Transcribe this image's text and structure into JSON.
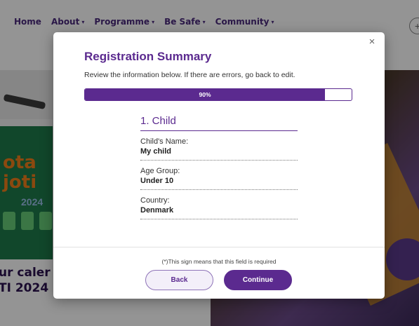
{
  "background": {
    "nav_items": [
      {
        "label": "Home",
        "has_caret": false
      },
      {
        "label": "About",
        "has_caret": true
      },
      {
        "label": "Programme",
        "has_caret": true
      },
      {
        "label": "Be Safe",
        "has_caret": true
      },
      {
        "label": "Community",
        "has_caret": true
      }
    ],
    "caret_glyph": "▾",
    "nav_circle_glyph": "+",
    "poster_text_line1": "ota",
    "poster_text_line2": "joti",
    "poster_year": "2024",
    "footer_text_line1": "ur caler",
    "footer_text_line2": "TI 2024"
  },
  "modal": {
    "close_glyph": "×",
    "title": "Registration Summary",
    "subtitle": "Review the information below. If there are errors, go back to edit.",
    "progress": {
      "value": 90,
      "label": "90%"
    },
    "section": {
      "title": "1. Child",
      "fields": [
        {
          "label": "Child's Name:",
          "value": "My child"
        },
        {
          "label": "Age Group:",
          "value": "Under 10"
        },
        {
          "label": "Country:",
          "value": "Denmark"
        }
      ]
    },
    "required_note": "(*)This sign means that this field is required",
    "back_label": "Back",
    "continue_label": "Continue"
  },
  "colors": {
    "primary_purple": "#5b2a8f",
    "nav_purple": "#4a2a7d",
    "poster_green": "#1e7b4a",
    "poster_orange": "#f07e1a"
  },
  "icons": {
    "close": "close-icon",
    "nav_caret": "chevron-down-icon",
    "nav_circle": "plus-icon"
  }
}
